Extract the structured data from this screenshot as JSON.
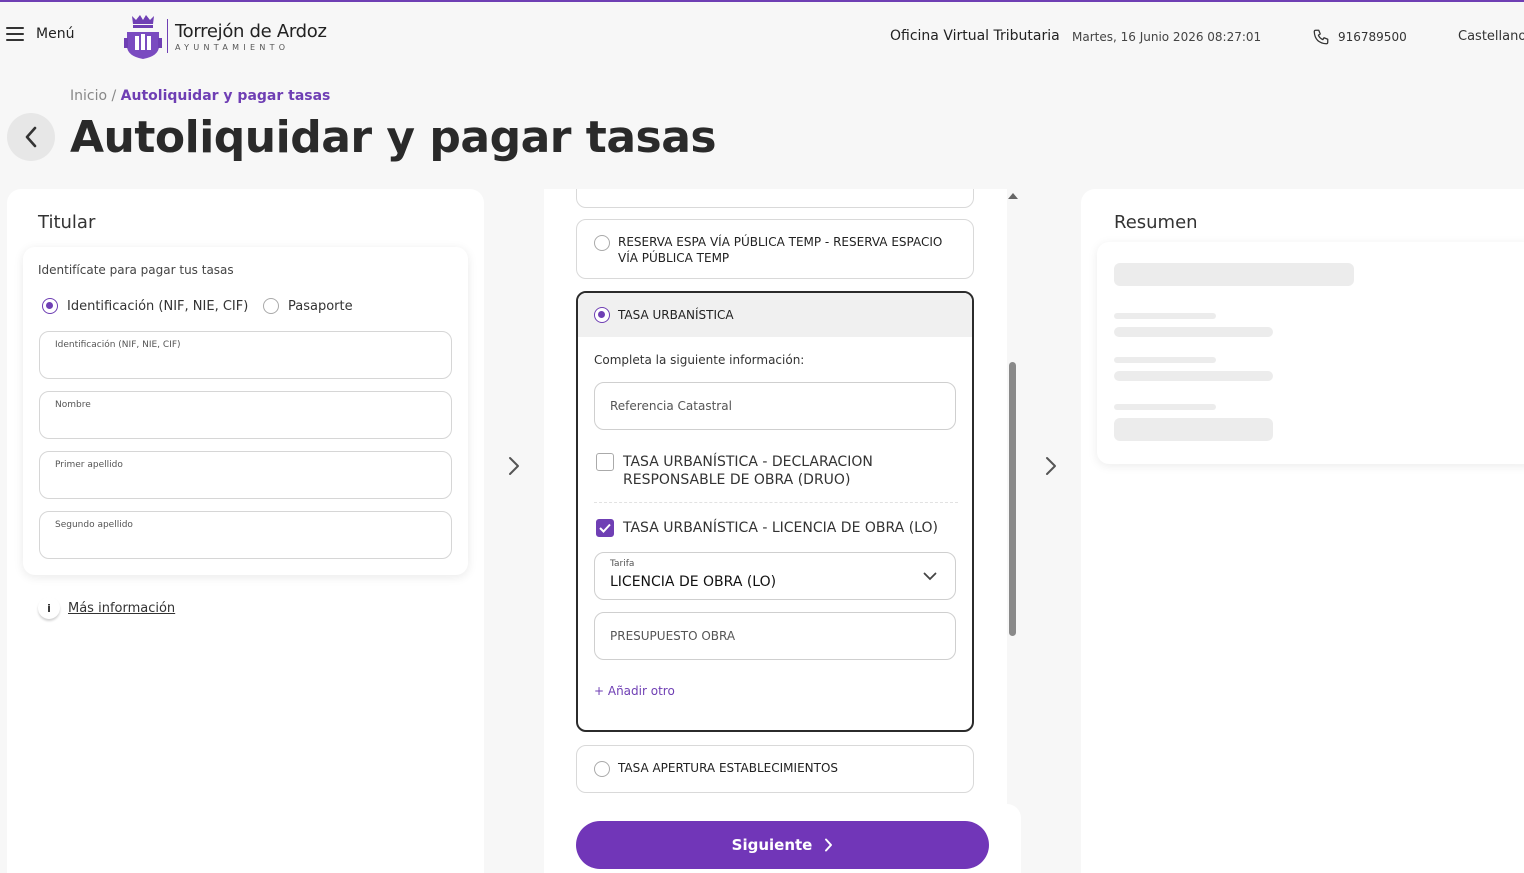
{
  "header": {
    "menu_label": "Menú",
    "logo_name": "Torrejón de Ardoz",
    "logo_sub": "AYUNTAMIENTO",
    "office": "Oficina Virtual Tributaria",
    "datetime": "Martes, 16 Junio 2026 08:27:01",
    "phone": "916789500",
    "language": "Castellano"
  },
  "breadcrumb": {
    "home": "Inicio",
    "separator": "/",
    "current": "Autoliquidar y pagar tasas"
  },
  "page_title": "Autoliquidar y pagar tasas",
  "titular": {
    "heading": "Titular",
    "hint": "Identifícate para pagar tus tasas",
    "id_types": [
      {
        "label": "Identificación (NIF, NIE, CIF)",
        "selected": true
      },
      {
        "label": "Pasaporte",
        "selected": false
      }
    ],
    "fields": {
      "identificacion": "Identificación (NIF, NIE, CIF)",
      "nombre": "Nombre",
      "primer_apellido": "Primer apellido",
      "segundo_apellido": "Segundo apellido"
    },
    "more_info": "Más información",
    "info_icon_text": "i"
  },
  "tasas": {
    "options": [
      {
        "label": "RESERVA ESPA VÍA PÚBLICA TEMP - RESERVA ESPACIO VÍA PÚBLICA TEMP",
        "selected": false
      },
      {
        "label": "TASA URBANÍSTICA",
        "selected": true
      },
      {
        "label": "TASA APERTURA ESTABLECIMIENTOS",
        "selected": false
      }
    ],
    "expanded": {
      "prompt": "Completa la siguiente información:",
      "referencia_placeholder": "Referencia Catastral",
      "checkboxes": [
        {
          "label": "TASA URBANÍSTICA - DECLARACION RESPONSABLE DE OBRA (DRUO)",
          "checked": false
        },
        {
          "label": "TASA URBANÍSTICA - LICENCIA DE OBRA (LO)",
          "checked": true
        }
      ],
      "tarifa_label": "Tarifa",
      "tarifa_value": "LICENCIA DE OBRA (LO)",
      "presupuesto_placeholder": "PRESUPUESTO OBRA",
      "add_other": "+ Añadir otro"
    }
  },
  "next_button": "Siguiente",
  "resumen": {
    "heading": "Resumen"
  },
  "colors": {
    "accent": "#7136b8",
    "text": "#222222",
    "panel": "#ffffff",
    "background": "#f7f7f7"
  }
}
